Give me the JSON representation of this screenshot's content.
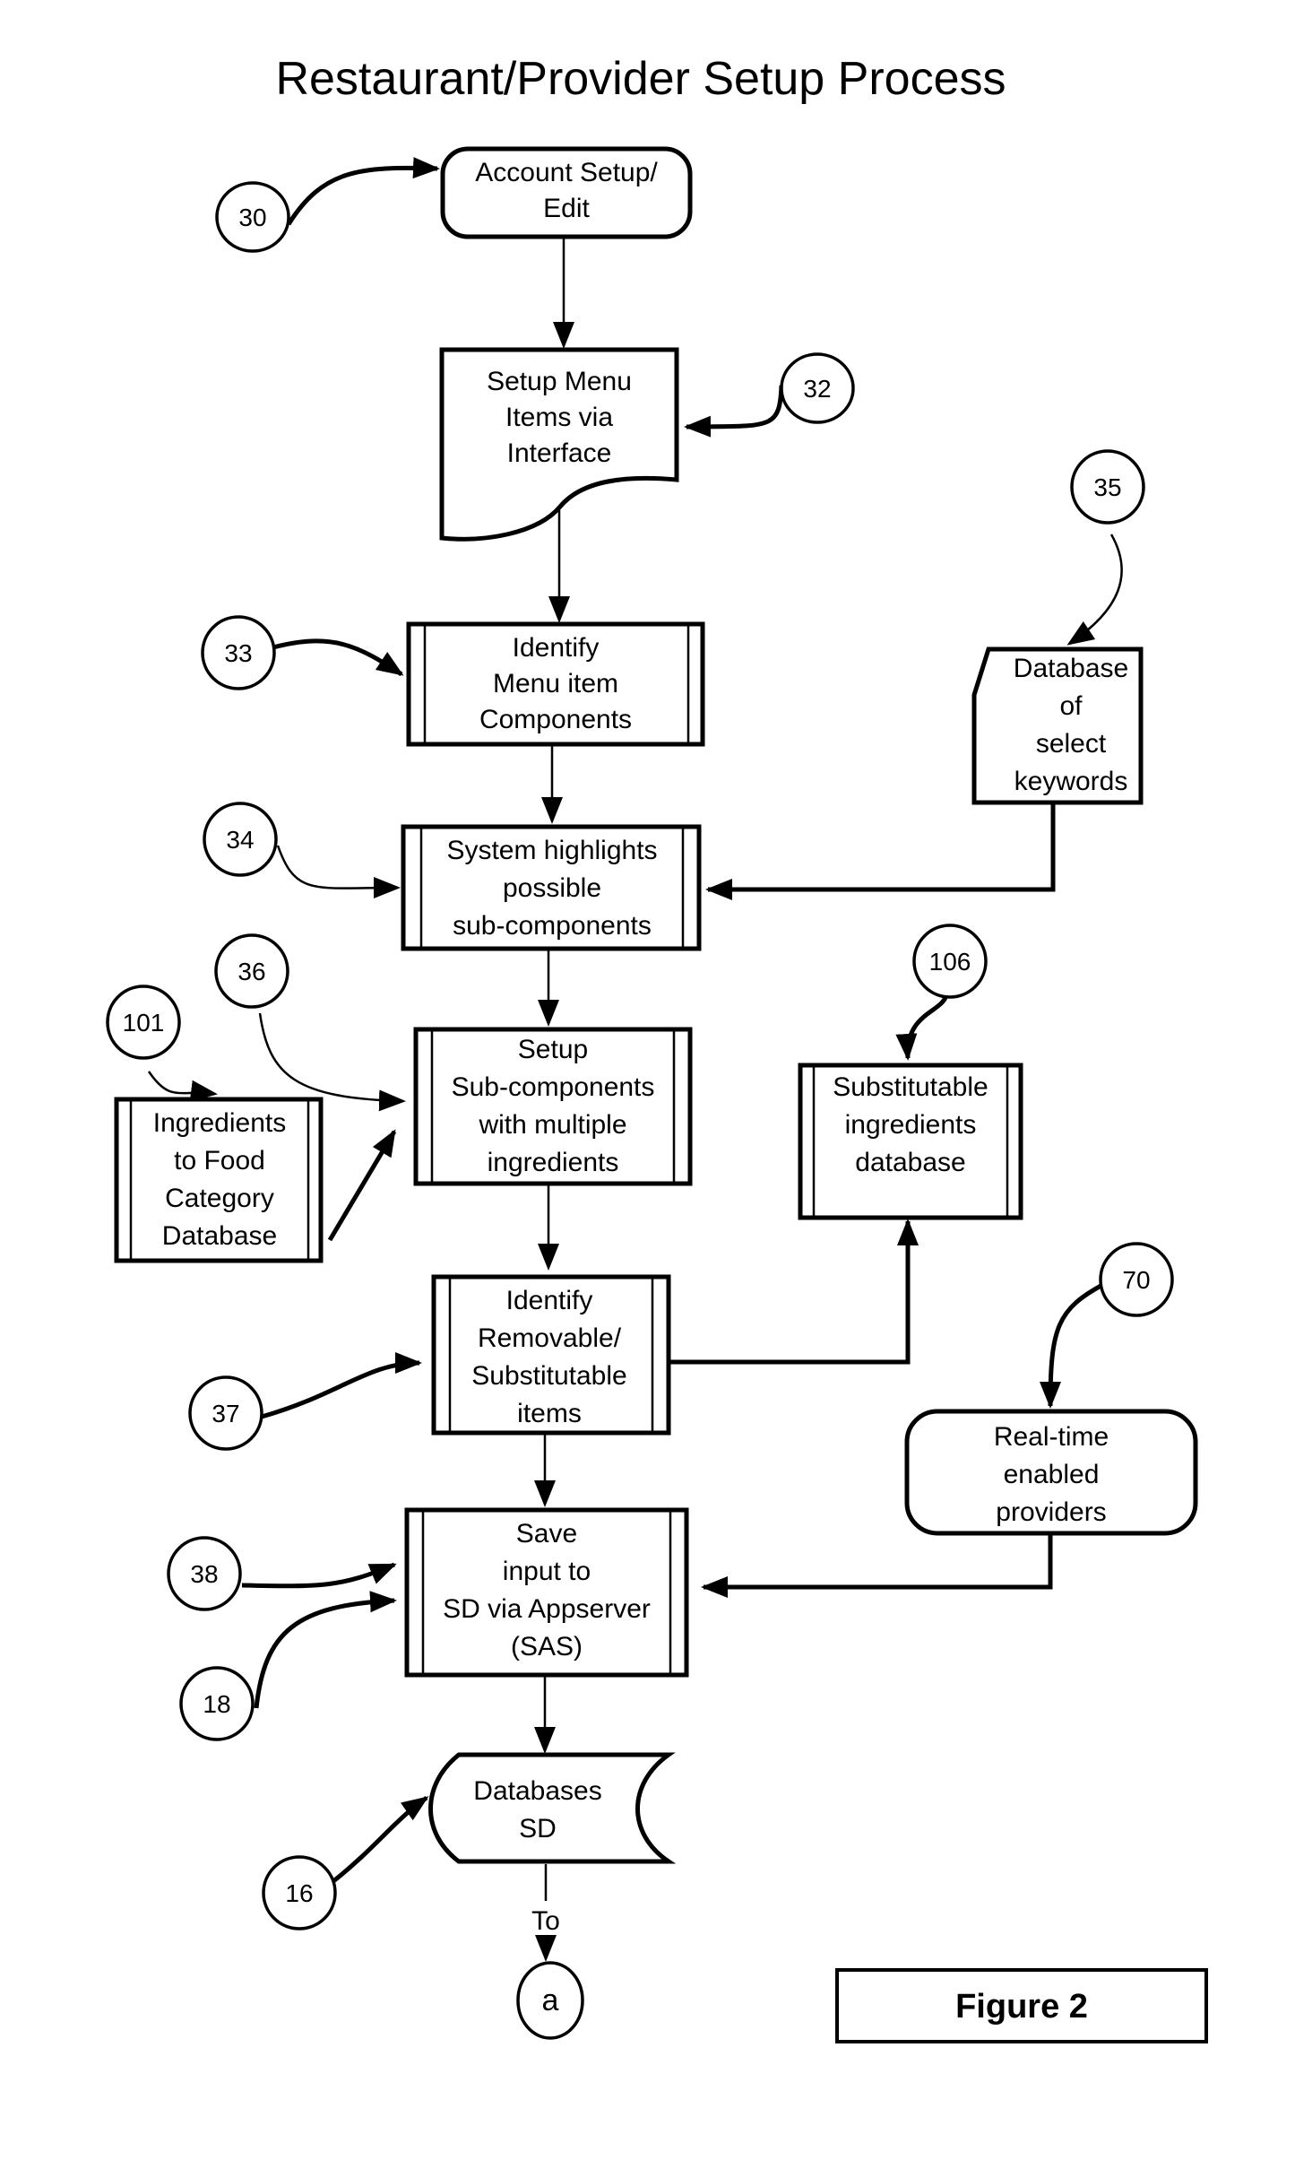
{
  "title": "Restaurant/Provider Setup Process",
  "figure_label": "Figure 2",
  "nodes": {
    "account_setup": {
      "ref": "30",
      "lines": [
        "Account Setup/",
        "Edit"
      ],
      "shape": "rounded-rectangle"
    },
    "setup_menu": {
      "ref": "32",
      "lines": [
        "Setup Menu",
        "Items via",
        "Interface"
      ],
      "shape": "document"
    },
    "identify_components": {
      "ref": "33",
      "lines": [
        "Identify",
        "Menu item",
        "Components"
      ],
      "shape": "predefined-process"
    },
    "keyword_db": {
      "ref": "35",
      "lines": [
        "Database",
        "of",
        "select",
        "keywords"
      ],
      "shape": "card"
    },
    "highlight_subcomponents": {
      "ref": "34",
      "lines": [
        "System highlights",
        "possible",
        "sub-components"
      ],
      "shape": "predefined-process"
    },
    "setup_subcomponents": {
      "ref": "36",
      "lines": [
        "Setup",
        "Sub-components",
        "with multiple",
        "ingredients"
      ],
      "shape": "predefined-process"
    },
    "ingredients_db": {
      "ref": "101",
      "lines": [
        "Ingredients",
        "to Food",
        "Category",
        "Database"
      ],
      "shape": "predefined-process"
    },
    "substitutable_db": {
      "ref": "106",
      "lines": [
        "Substitutable",
        "ingredients",
        "database"
      ],
      "shape": "predefined-process"
    },
    "identify_removable": {
      "ref": "37",
      "lines": [
        "Identify",
        "Removable/",
        "Substitutable",
        "items"
      ],
      "shape": "predefined-process"
    },
    "realtime_providers": {
      "ref": "70",
      "lines": [
        "Real-time",
        "enabled",
        "providers"
      ],
      "shape": "rounded-rectangle"
    },
    "save_input": {
      "refs": [
        "38",
        "18"
      ],
      "lines": [
        "Save",
        "input to",
        "SD via Appserver",
        "(SAS)"
      ],
      "shape": "predefined-process"
    },
    "databases_sd": {
      "ref": "16",
      "lines": [
        "Databases",
        "SD"
      ],
      "shape": "stored-data"
    },
    "connector_a": {
      "label": "a",
      "shape": "connector"
    }
  },
  "edges": [
    {
      "from": "account_setup",
      "to": "setup_menu"
    },
    {
      "from": "setup_menu",
      "to": "identify_components"
    },
    {
      "from": "identify_components",
      "to": "highlight_subcomponents"
    },
    {
      "from": "keyword_db",
      "to": "highlight_subcomponents"
    },
    {
      "from": "highlight_subcomponents",
      "to": "setup_subcomponents"
    },
    {
      "from": "ingredients_db",
      "to": "setup_subcomponents"
    },
    {
      "from": "setup_subcomponents",
      "to": "identify_removable"
    },
    {
      "from": "identify_removable",
      "to": "substitutable_db"
    },
    {
      "from": "identify_removable",
      "to": "save_input"
    },
    {
      "from": "realtime_providers",
      "to": "save_input"
    },
    {
      "from": "save_input",
      "to": "databases_sd"
    },
    {
      "from": "databases_sd",
      "to": "connector_a",
      "label": "To"
    }
  ],
  "refs": {
    "r30": "30",
    "r32": "32",
    "r33": "33",
    "r34": "34",
    "r35": "35",
    "r36": "36",
    "r101": "101",
    "r106": "106",
    "r37": "37",
    "r70": "70",
    "r38": "38",
    "r18": "18",
    "r16": "16"
  },
  "edge_label_to": "To"
}
